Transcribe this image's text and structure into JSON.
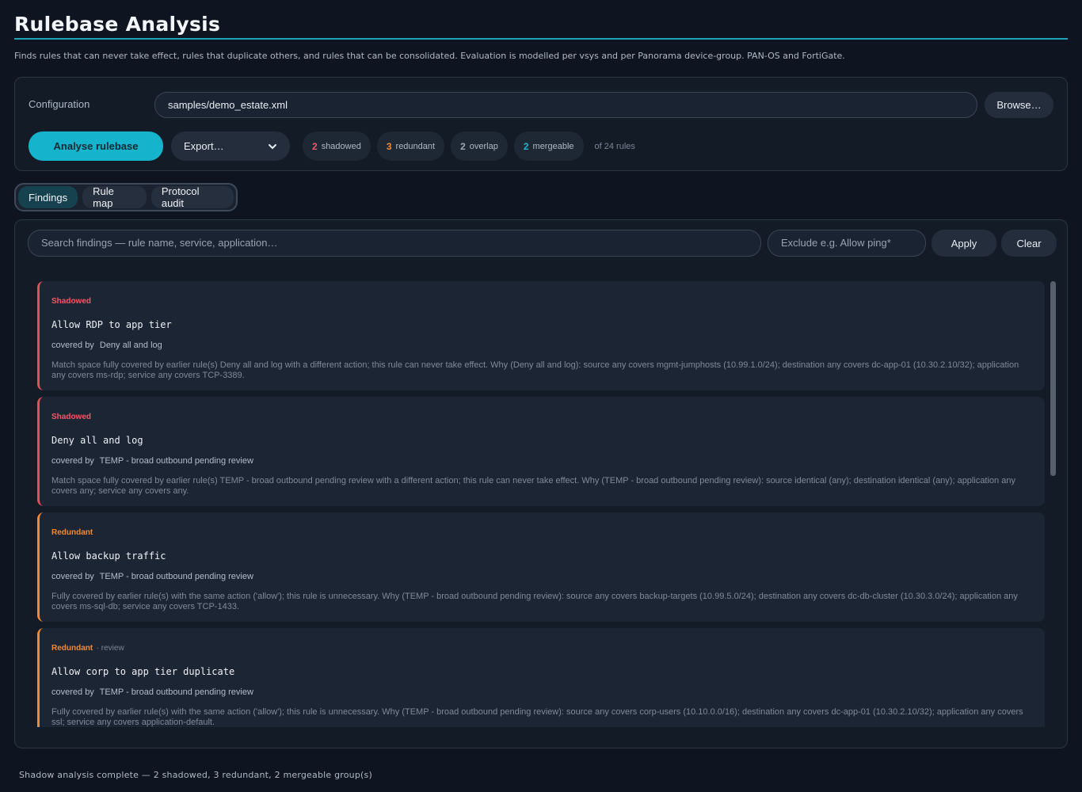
{
  "header": {
    "title": "Rulebase Analysis",
    "subtitle": "Finds rules that can never take effect, rules that duplicate others, and rules that can be consolidated. Evaluation is modelled per vsys and per Panorama device-group. PAN-OS and FortiGate."
  },
  "config": {
    "label": "Configuration",
    "path": "samples/demo_estate.xml",
    "browse_label": "Browse…",
    "analyse_label": "Analyse rulebase",
    "export_label": "Export…",
    "export_icon": "chevron-down-icon"
  },
  "stats": {
    "shadowed": {
      "count": "2",
      "label": "shadowed",
      "color": "#ef5a66"
    },
    "redundant": {
      "count": "3",
      "label": "redundant",
      "color": "#f08a36"
    },
    "overlap": {
      "count": "2",
      "label": "overlap",
      "color": "#9aa5b5"
    },
    "mergeable": {
      "count": "2",
      "label": "mergeable",
      "color": "#1fb6cc"
    },
    "total": "of 24 rules"
  },
  "tabs": [
    {
      "label": "Findings",
      "active": true
    },
    {
      "label": "Rule map",
      "active": false
    },
    {
      "label": "Protocol audit",
      "active": false
    }
  ],
  "filters": {
    "search_placeholder": "Search findings — rule name, service, application…",
    "exclude_placeholder": "Exclude e.g. Allow ping*",
    "apply_label": "Apply",
    "clear_label": "Clear"
  },
  "findings": [
    {
      "kind": "Shadowed",
      "note": "",
      "rule": "Allow RDP to app tier",
      "covered_prefix": "covered by",
      "covered_by": "Deny all and log",
      "detail": "Match space fully covered by earlier rule(s) Deny all and log with a different action; this rule can never take effect. Why (Deny all and log): source any covers mgmt-jumphosts (10.99.1.0/24); destination any covers dc-app-01 (10.30.2.10/32); application any covers ms-rdp; service any covers TCP-3389."
    },
    {
      "kind": "Shadowed",
      "note": "",
      "rule": "Deny all and log",
      "covered_prefix": "covered by",
      "covered_by": "TEMP - broad outbound pending review",
      "detail": "Match space fully covered by earlier rule(s) TEMP - broad outbound pending review with a different action; this rule can never take effect. Why (TEMP - broad outbound pending review): source identical (any); destination identical (any); application any covers any; service any covers any."
    },
    {
      "kind": "Redundant",
      "note": "",
      "rule": "Allow backup traffic",
      "covered_prefix": "covered by",
      "covered_by": "TEMP - broad outbound pending review",
      "detail": "Fully covered by earlier rule(s) with the same action ('allow'); this rule is unnecessary. Why (TEMP - broad outbound pending review): source any covers backup-targets (10.99.5.0/24); destination any covers dc-db-cluster (10.30.3.0/24); application any covers ms-sql-db; service any covers TCP-1433."
    },
    {
      "kind": "Redundant",
      "note": "· review",
      "rule": "Allow corp to app tier duplicate",
      "covered_prefix": "covered by",
      "covered_by": "TEMP - broad outbound pending review",
      "detail": "Fully covered by earlier rule(s) with the same action ('allow'); this rule is unnecessary. Why (TEMP - broad outbound pending review): source any covers corp-users (10.10.0.0/16); destination any covers dc-app-01 (10.30.2.10/32); application any covers ssl; service any covers application-default."
    }
  ],
  "status": "Shadow analysis complete — 2 shadowed, 3 redundant, 2 mergeable group(s)"
}
